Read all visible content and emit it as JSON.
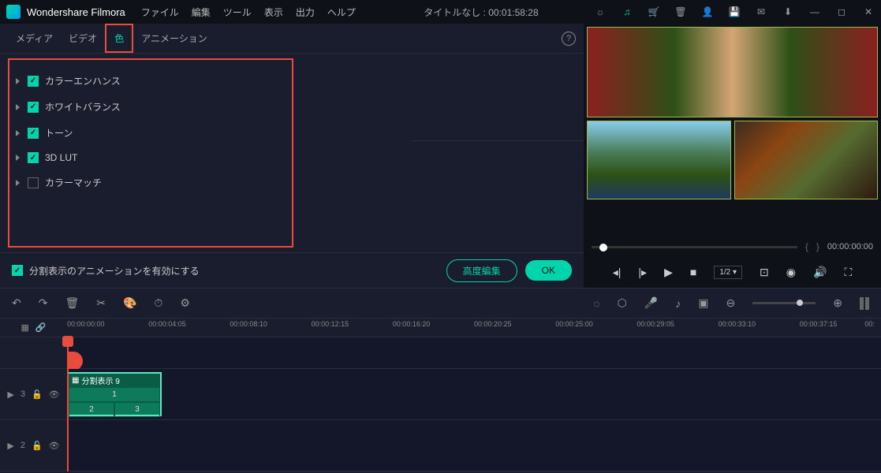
{
  "app": {
    "name": "Wondershare Filmora"
  },
  "menu": [
    "ファイル",
    "編集",
    "ツール",
    "表示",
    "出力",
    "ヘルプ"
  ],
  "title": "タイトルなし : 00:01:58:28",
  "tabs": [
    "メディア",
    "ビデオ",
    "色",
    "アニメーション"
  ],
  "active_tab": 2,
  "color_items": [
    {
      "label": "カラーエンハンス",
      "checked": true
    },
    {
      "label": "ホワイトバランス",
      "checked": true
    },
    {
      "label": "トーン",
      "checked": true
    },
    {
      "label": "3D LUT",
      "checked": true
    },
    {
      "label": "カラーマッチ",
      "checked": false
    }
  ],
  "anim_label": "分割表示のアニメーションを有効にする",
  "btn_advanced": "高度編集",
  "btn_ok": "OK",
  "preview_time": "00:00:00:00",
  "speed": "1/2",
  "ruler_ticks": [
    "00:00:00:00",
    "00:00:04:05",
    "00:00:08:10",
    "00:00:12:15",
    "00:00:16:20",
    "00:00:20:25",
    "00:00:25:00",
    "00:00:29:05",
    "00:00:33:10",
    "00:00:37:15",
    "00:"
  ],
  "clip_name": "分割表示 9",
  "clip_cells": [
    "1",
    "2",
    "3"
  ],
  "track_labels": [
    "3",
    "2"
  ]
}
